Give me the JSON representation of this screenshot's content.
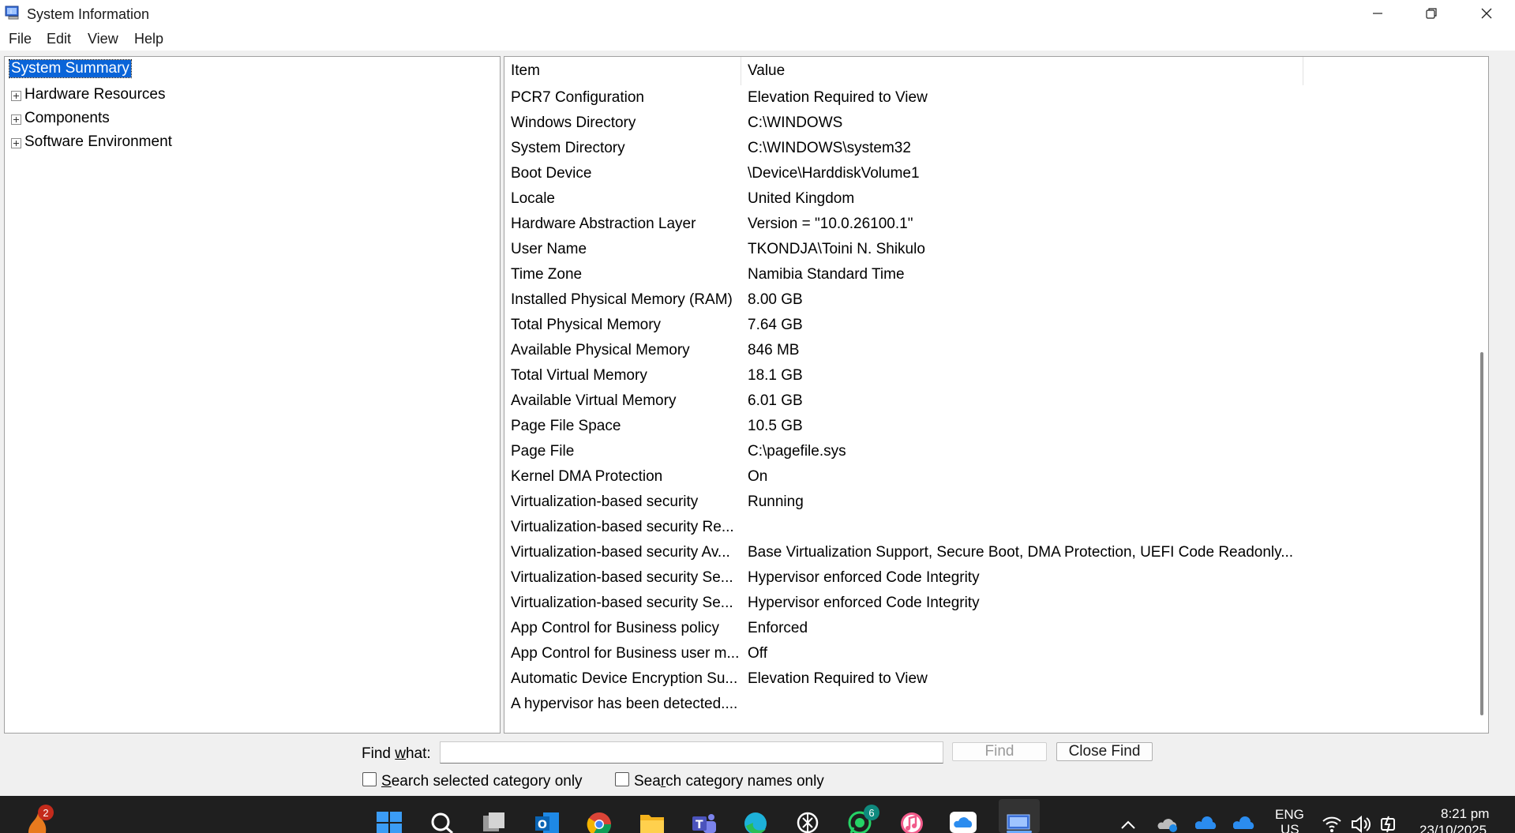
{
  "window": {
    "title": "System Information",
    "minimize_icon": "minimize-icon",
    "maximize_icon": "restore-icon",
    "close_icon": "close-icon"
  },
  "menu": [
    "File",
    "Edit",
    "View",
    "Help"
  ],
  "tree": {
    "selected": "System Summary",
    "items": [
      "Hardware Resources",
      "Components",
      "Software Environment"
    ]
  },
  "table": {
    "columns": [
      "Item",
      "Value"
    ],
    "rows": [
      [
        "PCR7 Configuration",
        "Elevation Required to View"
      ],
      [
        "Windows Directory",
        "C:\\WINDOWS"
      ],
      [
        "System Directory",
        "C:\\WINDOWS\\system32"
      ],
      [
        "Boot Device",
        "\\Device\\HarddiskVolume1"
      ],
      [
        "Locale",
        "United Kingdom"
      ],
      [
        "Hardware Abstraction Layer",
        "Version = \"10.0.26100.1\""
      ],
      [
        "User Name",
        "TKONDJA\\Toini N. Shikulo"
      ],
      [
        "Time Zone",
        "Namibia Standard Time"
      ],
      [
        "Installed Physical Memory (RAM)",
        "8.00 GB"
      ],
      [
        "Total Physical Memory",
        "7.64 GB"
      ],
      [
        "Available Physical Memory",
        "846 MB"
      ],
      [
        "Total Virtual Memory",
        "18.1 GB"
      ],
      [
        "Available Virtual Memory",
        "6.01 GB"
      ],
      [
        "Page File Space",
        "10.5 GB"
      ],
      [
        "Page File",
        "C:\\pagefile.sys"
      ],
      [
        "Kernel DMA Protection",
        "On"
      ],
      [
        "Virtualization-based security",
        "Running"
      ],
      [
        "Virtualization-based security Re...",
        ""
      ],
      [
        "Virtualization-based security Av...",
        "Base Virtualization Support, Secure Boot, DMA Protection, UEFI Code Readonly..."
      ],
      [
        "Virtualization-based security Se...",
        "Hypervisor enforced Code Integrity"
      ],
      [
        "Virtualization-based security Se...",
        "Hypervisor enforced Code Integrity"
      ],
      [
        "App Control for Business policy",
        "Enforced"
      ],
      [
        "App Control for Business user m...",
        "Off"
      ],
      [
        "Automatic Device Encryption Su...",
        "Elevation Required to View"
      ],
      [
        "A hypervisor has been detected....",
        ""
      ]
    ]
  },
  "find": {
    "label_pre": "Find ",
    "label_accel": "w",
    "label_post": "hat:",
    "value": "",
    "find_button": "Find",
    "close_button": "Close Find",
    "check1_accel": "S",
    "check1_rest": "earch selected category only",
    "check2_pre": "Sea",
    "check2_accel": "r",
    "check2_rest": "ch category names only"
  },
  "taskbar": {
    "badges": {
      "app1": "2",
      "whatsapp": "6"
    },
    "language_top": "ENG",
    "language_bottom": "US",
    "time": "8:21 pm",
    "date": "23/10/2025"
  },
  "colors": {
    "selection": "#0a64d8",
    "taskbar": "#1f1f1f",
    "badge_red": "#c42b1c",
    "badge_teal": "#0f8a7e"
  }
}
